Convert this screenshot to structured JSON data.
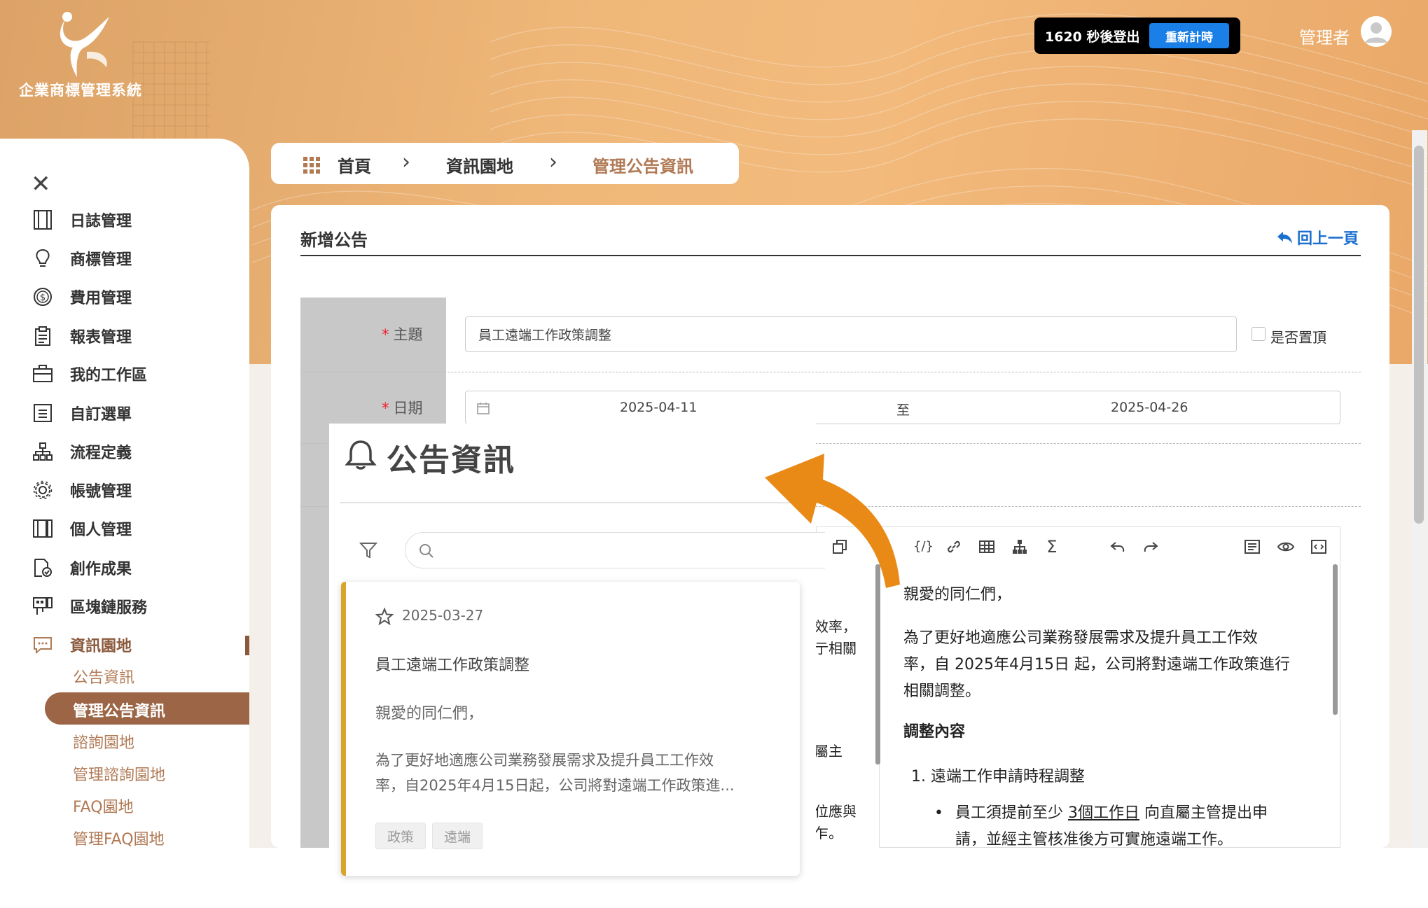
{
  "app": {
    "logo_text": "企業商標管理系統"
  },
  "session": {
    "countdown_text": "1620 秒後登出",
    "reset_label": "重新計時",
    "user_name": "管理者"
  },
  "sidebar": {
    "items": [
      {
        "label": "日誌管理",
        "icon": "journal-icon"
      },
      {
        "label": "商標管理",
        "icon": "lightbulb-icon"
      },
      {
        "label": "費用管理",
        "icon": "dollar-icon"
      },
      {
        "label": "報表管理",
        "icon": "clipboard-icon"
      },
      {
        "label": "我的工作區",
        "icon": "briefcase-icon"
      },
      {
        "label": "自訂選單",
        "icon": "list-icon"
      },
      {
        "label": "流程定義",
        "icon": "flow-icon"
      },
      {
        "label": "帳號管理",
        "icon": "gear-icon"
      },
      {
        "label": "個人管理",
        "icon": "book-icon"
      },
      {
        "label": "創作成果",
        "icon": "creation-icon"
      },
      {
        "label": "區塊鏈服務",
        "icon": "blockchain-icon"
      },
      {
        "label": "資訊園地",
        "icon": "message-icon"
      }
    ],
    "sub_items": [
      "公告資訊",
      "管理公告資訊",
      "諮詢園地",
      "管理諮詢園地",
      "FAQ園地",
      "管理FAQ園地"
    ]
  },
  "breadcrumb": {
    "home": "首頁",
    "section": "資訊園地",
    "current": "管理公告資訊"
  },
  "form": {
    "panel_title": "新增公告",
    "back_label": "回上一頁",
    "subject_label": "主題",
    "subject_value": "員工遠端工作政策調整",
    "pin_label": "是否置頂",
    "date_label": "日期",
    "date_start": "2025-04-11",
    "date_sep": "至",
    "date_end": "2025-04-26"
  },
  "editor": {
    "para1": "親愛的同仁們，",
    "para2_line1": "為了更好地適應公司業務發展需求及提升員工工作效",
    "para2_line2": "率，自 2025年4月15日 起，公司將對遠端工作政策進行",
    "para2_line3": "相關調整。",
    "heading": "調整內容",
    "list1": "1.  遠端工作申請時程調整",
    "bullet1_pre": "員工須提前至少 ",
    "bullet1_link": "3個工作日",
    "bullet1_post": " 向直屬主管提出申",
    "bullet1_line2": "請，並經主管核准後方可實施遠端工作。",
    "frag1": "效率，",
    "frag2": "亍相關",
    "frag3": "屬主",
    "frag4": "位應與",
    "frag5": "乍。"
  },
  "overlay": {
    "title": "公告資訊",
    "card_date": "2025-03-27",
    "card_title": "員工遠端工作政策調整",
    "card_greeting": "親愛的同仁們，",
    "card_body_line1": "為了更好地適應公司業務發展需求及提升員工工作效",
    "card_body_line2": "率，自2025年4月15日起，公司將對遠端工作政策進...",
    "tags": [
      "政策",
      "遠端"
    ]
  },
  "colors": {
    "accent_brown": "#9b6546",
    "link_blue": "#1a6fcf",
    "arrow_orange": "#ea8a16",
    "card_accent": "#d8a52a"
  }
}
